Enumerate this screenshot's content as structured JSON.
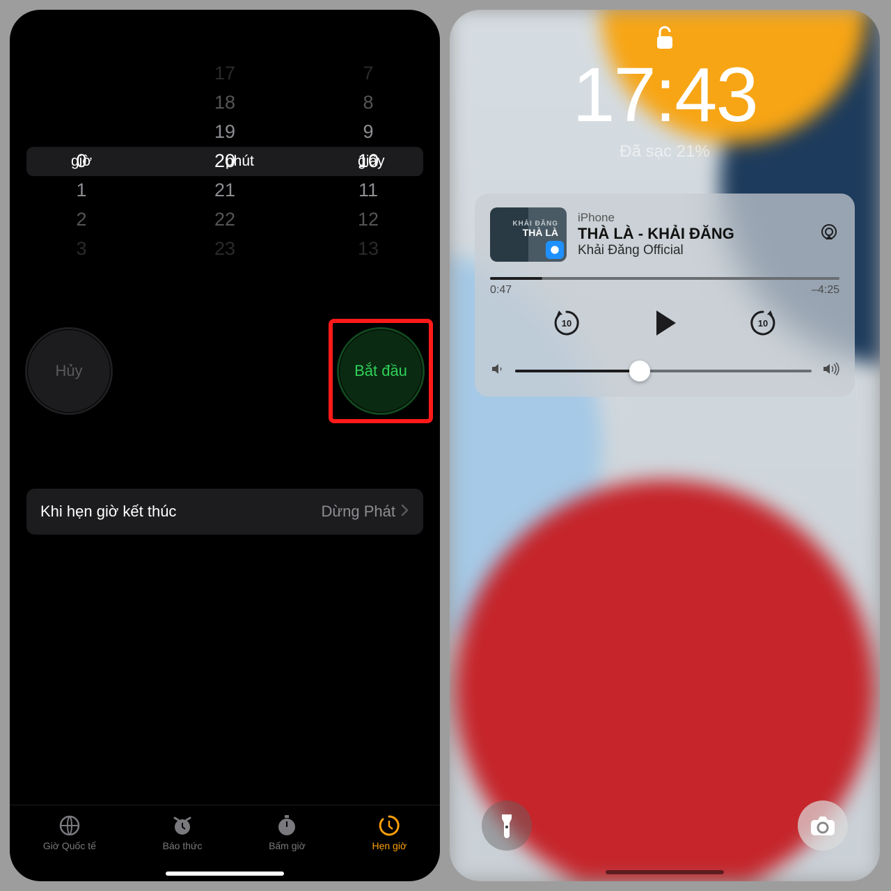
{
  "left": {
    "picker": {
      "hours": {
        "rows": [
          "",
          "",
          "",
          "0",
          "1",
          "2",
          "3"
        ],
        "unit": "giờ"
      },
      "minutes": {
        "rows": [
          "17",
          "18",
          "19",
          "20",
          "21",
          "22",
          "23"
        ],
        "unit": "phút"
      },
      "seconds": {
        "rows": [
          "7",
          "8",
          "9",
          "10",
          "11",
          "12",
          "13"
        ],
        "unit": "giây"
      }
    },
    "cancel": "Hủy",
    "start": "Bắt đầu",
    "when_ends_label": "Khi hẹn giờ kết thúc",
    "when_ends_value": "Dừng Phát",
    "tabs": [
      "Giờ Quốc tế",
      "Báo thức",
      "Bấm giờ",
      "Hẹn giờ"
    ]
  },
  "right": {
    "time": "17:43",
    "charge": "Đã sạc 21%",
    "media": {
      "source": "iPhone",
      "title": "THÀ LÀ - KHẢI ĐĂNG",
      "artist": "Khải Đăng Official",
      "art_line1": "KHẢI ĐĂNG",
      "art_line2": "THÀ LÀ",
      "elapsed": "0:47",
      "remain": "–4:25",
      "skip": "10"
    }
  }
}
